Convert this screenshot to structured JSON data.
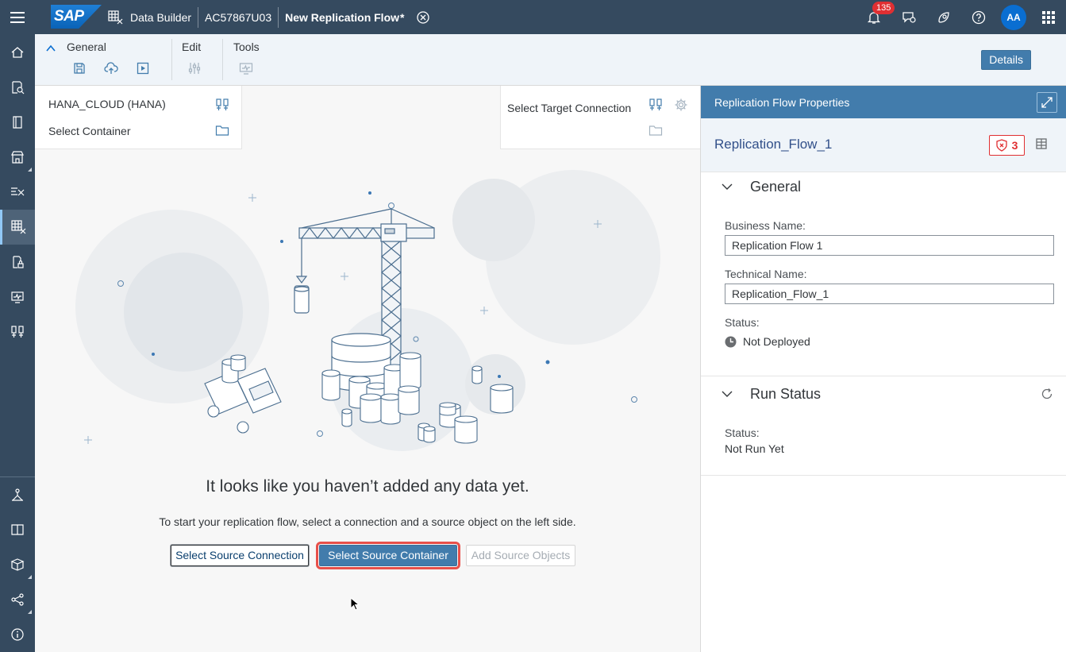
{
  "shell": {
    "logo": "SAP",
    "app_name": "Data Builder",
    "space": "AC57867U03",
    "document": "New Replication Flow",
    "modified_marker": "*",
    "notifications_count": "135",
    "avatar_initials": "AA"
  },
  "toolbar": {
    "general_label": "General",
    "edit_label": "Edit",
    "tools_label": "Tools",
    "details_label": "Details"
  },
  "source": {
    "connection": "HANA_CLOUD (HANA)",
    "container": "Select Container"
  },
  "target": {
    "connection": "Select Target Connection"
  },
  "empty_state": {
    "title": "It looks like you haven’t added any data yet.",
    "subtitle": "To start your replication flow, select a connection and a source object on the left side.",
    "btn_select_source_connection": "Select Source Connection",
    "btn_select_source_container": "Select Source Container",
    "btn_add_source_objects": "Add Source Objects"
  },
  "panel": {
    "title": "Replication Flow Properties",
    "object_name": "Replication_Flow_1",
    "error_count": "3",
    "general": {
      "title": "General",
      "business_name_label": "Business Name:",
      "business_name_value": "Replication Flow 1",
      "technical_name_label": "Technical Name:",
      "technical_name_value": "Replication_Flow_1",
      "status_label": "Status:",
      "status_value": "Not Deployed"
    },
    "run_status": {
      "title": "Run Status",
      "status_label": "Status:",
      "status_value": "Not Run Yet"
    }
  },
  "colors": {
    "shell": "#354a5f",
    "accent": "#427cac",
    "error": "#e02f32",
    "highlight": "#e8504a"
  }
}
